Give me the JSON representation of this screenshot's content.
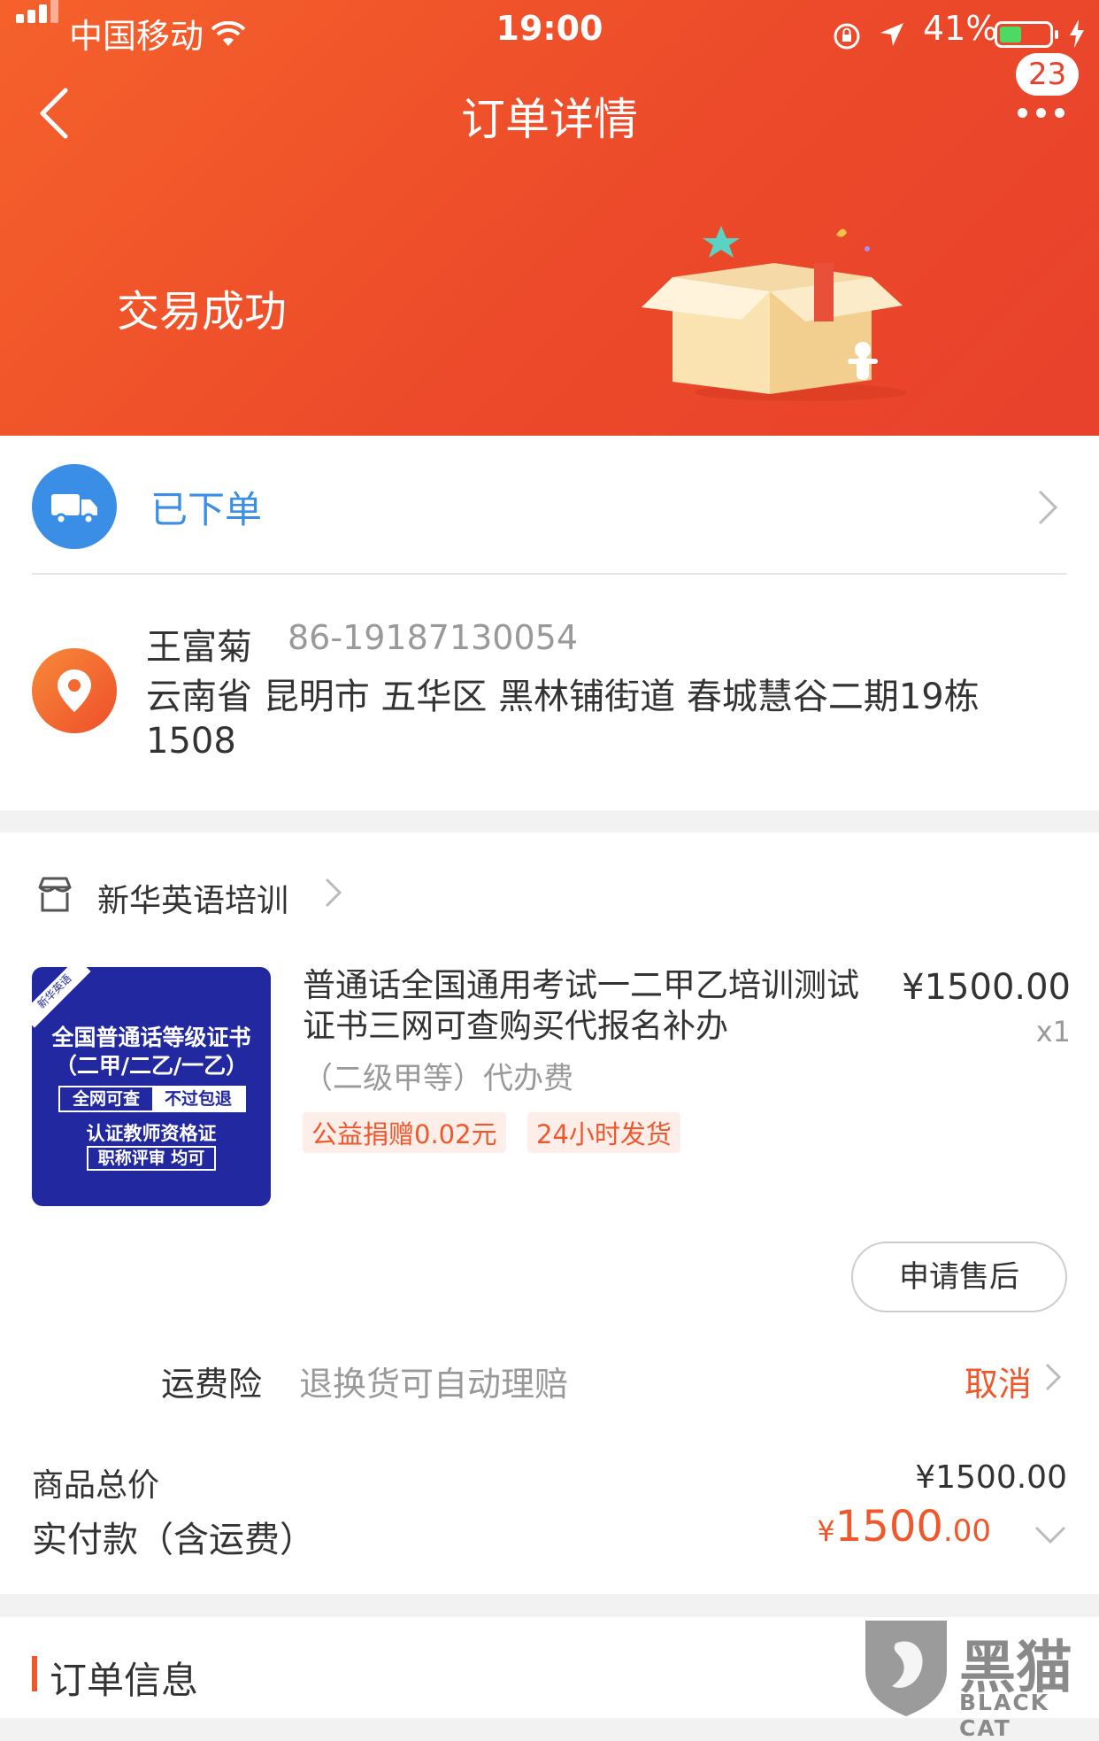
{
  "status_bar": {
    "carrier": "中国移动",
    "time": "19:00",
    "battery": "41%"
  },
  "nav": {
    "title": "订单详情",
    "badge": "23"
  },
  "order_status": "交易成功",
  "logistics": {
    "status": "已下单"
  },
  "address": {
    "name": "王富菊",
    "phone": "86-19187130054",
    "detail": "云南省 昆明市 五华区 黑林铺街道 春城慧谷二期19栋1508"
  },
  "store": {
    "name": "新华英语培训"
  },
  "product": {
    "thumb": {
      "corner": "新华英语",
      "line1": "全国普通话等级证书",
      "line2": "（二甲/二乙/一乙）",
      "line3a": "全网可查",
      "line3b": "不过包退",
      "line4": "认证教师资格证",
      "line5": "职称评审 均可"
    },
    "title": "普通话全国通用考试一二甲乙培训测试证书三网可查购买代报名补办",
    "sku": "（二级甲等）代办费",
    "tags": [
      "公益捐赠0.02元",
      "24小时发货"
    ],
    "price": "¥1500.00",
    "qty": "x1",
    "after_sale": "申请售后"
  },
  "insurance": {
    "label": "运费险",
    "desc": "退换货可自动理赔",
    "action": "取消"
  },
  "totals": {
    "goods_label": "商品总价",
    "goods_value": "¥1500.00",
    "paid_label": "实付款（含运费）",
    "paid_currency": "¥",
    "paid_int": "1500",
    "paid_dec": ".00"
  },
  "order_info": {
    "title": "订单信息"
  },
  "watermark": {
    "cn": "黑猫",
    "en": "BLACK CAT"
  },
  "colors": {
    "accent": "#f0572b",
    "hero": "#ec4a2a",
    "logistics_blue": "#3a8ee6"
  }
}
